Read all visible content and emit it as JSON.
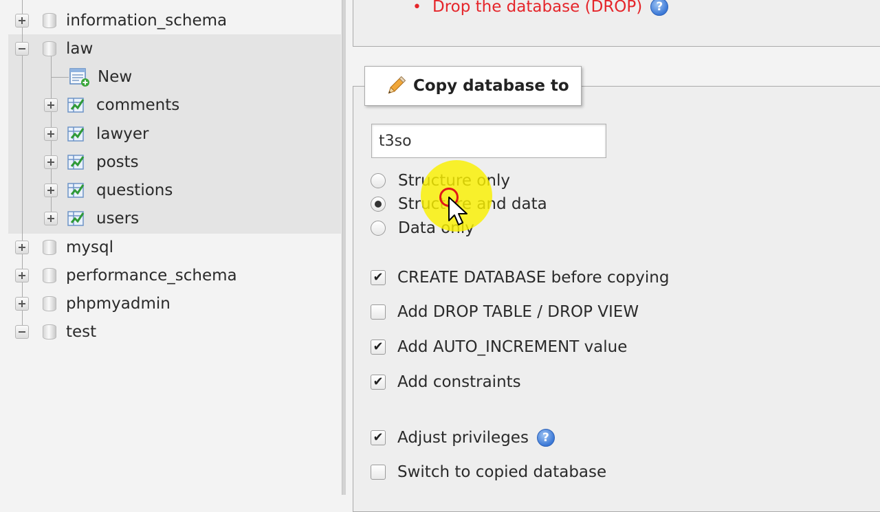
{
  "nav": {
    "databases": [
      {
        "label": "information_schema",
        "expander": "plus"
      },
      {
        "label": "law",
        "expander": "minus"
      },
      {
        "label": "mysql",
        "expander": "plus"
      },
      {
        "label": "performance_schema",
        "expander": "plus"
      },
      {
        "label": "phpmyadmin",
        "expander": "plus"
      },
      {
        "label": "test",
        "expander": "minus"
      }
    ],
    "law_children": {
      "new_label": "New",
      "tables": [
        "comments",
        "lawyer",
        "posts",
        "questions",
        "users"
      ]
    }
  },
  "operations": {
    "drop_link": "Drop the database (DROP)",
    "copy_section": {
      "title": "Copy database to",
      "db_name_value": "t3so",
      "mode_options": [
        {
          "label": "Structure only",
          "selected": false
        },
        {
          "label": "Structure and data",
          "selected": true
        },
        {
          "label": "Data only",
          "selected": false
        }
      ],
      "options": [
        {
          "label": "CREATE DATABASE before copying",
          "checked": true
        },
        {
          "label": "Add DROP TABLE / DROP VIEW",
          "checked": false
        },
        {
          "label": "Add AUTO_INCREMENT value",
          "checked": true
        },
        {
          "label": "Add constraints",
          "checked": true
        },
        {
          "label": "Adjust privileges",
          "checked": true
        },
        {
          "label": "Switch to copied database",
          "checked": false
        }
      ]
    }
  },
  "icons": {
    "help": "help-icon",
    "pencil": "pencil-icon",
    "database": "database-icon",
    "table": "table-icon",
    "new": "new-table-icon",
    "expander": "expand-icon"
  },
  "colors": {
    "drop_link": "#e5252a",
    "help_icon": "#3b78d6",
    "cursor_highlight": "#f5e600"
  }
}
